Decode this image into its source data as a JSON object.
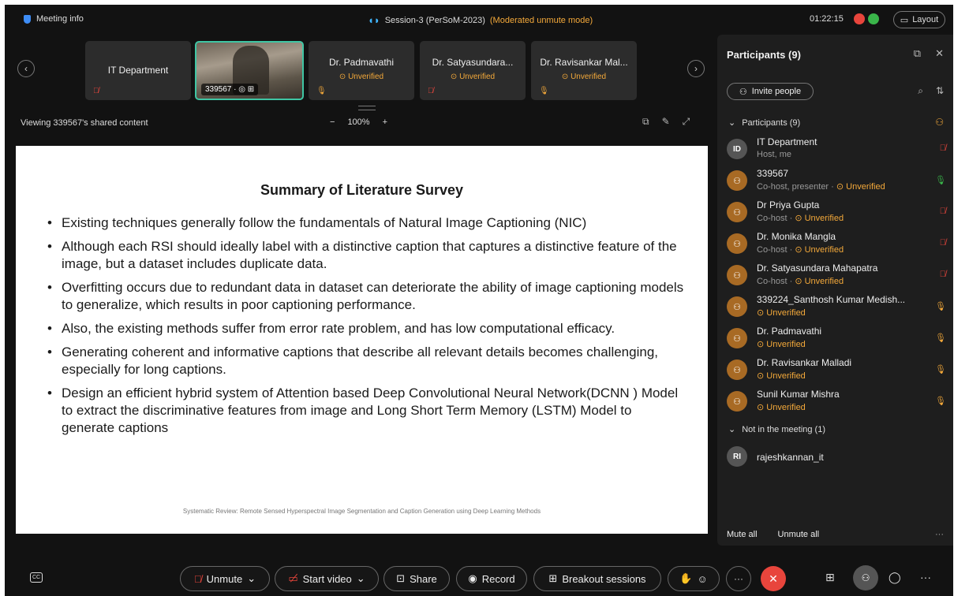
{
  "topbar": {
    "meeting_info": "Meeting info",
    "session_title": "Session-3 (PerSoM-2023)",
    "session_mode": "(Moderated unmute mode)",
    "timer": "01:22:15",
    "layout_label": "Layout"
  },
  "thumbnails": [
    {
      "name": "IT Department",
      "status": ""
    },
    {
      "name": "339567",
      "status": ""
    },
    {
      "name": "Dr. Padmavathi",
      "status": "Unverified"
    },
    {
      "name": "Dr. Satyasundara...",
      "status": "Unverified"
    },
    {
      "name": "Dr. Ravisankar Mal...",
      "status": "Unverified"
    }
  ],
  "viewbar": {
    "viewing": "Viewing 339567's shared content",
    "zoom": "100%",
    "zoom_minus": "−",
    "zoom_plus": "+"
  },
  "slide": {
    "title": "Summary of Literature Survey",
    "bullets": [
      "Existing techniques generally follow the fundamentals of Natural Image Captioning (NIC)",
      "Although each RSI should ideally label with a distinctive caption that captures a distinctive feature of the image, but a dataset includes duplicate data.",
      "Overfitting occurs due to redundant data in dataset can deteriorate the ability of image captioning models to generalize, which results in poor captioning performance.",
      "Also, the existing methods suffer from error rate problem, and has low computational efficacy.",
      "Generating coherent and informative captions that describe all relevant details becomes challenging, especially for long captions.",
      "Design an efficient hybrid system of Attention based Deep Convolutional Neural Network(DCNN ) Model to extract the discriminative features from image and Long Short Term Memory (LSTM) Model to generate captions"
    ],
    "footer": "Systematic Review: Remote Sensed Hyperspectral Image Segmentation and Caption Generation using Deep Learning Methods"
  },
  "panel": {
    "title": "Participants (9)",
    "invite": "Invite people",
    "section_in": "Participants (9)",
    "section_out": "Not in the meeting (1)",
    "participants": [
      {
        "initials": "ID",
        "name": "IT Department",
        "role": "Host, me",
        "status": ""
      },
      {
        "initials": "",
        "name": "339567",
        "role": "Co-host, presenter",
        "status": "Unverified"
      },
      {
        "initials": "",
        "name": "Dr Priya Gupta",
        "role": "Co-host",
        "status": "Unverified"
      },
      {
        "initials": "",
        "name": "Dr. Monika Mangla",
        "role": "Co-host",
        "status": "Unverified"
      },
      {
        "initials": "",
        "name": "Dr. Satyasundara Mahapatra",
        "role": "Co-host",
        "status": "Unverified"
      },
      {
        "initials": "",
        "name": "339224_Santhosh Kumar Medish...",
        "role": "",
        "status": "Unverified"
      },
      {
        "initials": "",
        "name": "Dr. Padmavathi",
        "role": "",
        "status": "Unverified"
      },
      {
        "initials": "",
        "name": "Dr. Ravisankar Malladi",
        "role": "",
        "status": "Unverified"
      },
      {
        "initials": "",
        "name": "Sunil Kumar Mishra",
        "role": "",
        "status": "Unverified"
      }
    ],
    "not_in_meeting": [
      {
        "initials": "RI",
        "name": "rajeshkannan_it"
      }
    ],
    "mute_all": "Mute all",
    "unmute_all": "Unmute all",
    "more": "···"
  },
  "controls": {
    "unmute": "Unmute",
    "start_video": "Start video",
    "share": "Share",
    "record": "Record",
    "breakout": "Breakout sessions",
    "more": "···"
  },
  "colors": {
    "accent_orange": "#f4a93a",
    "end_red": "#e8453c",
    "active_teal": "#3fc6a4"
  }
}
